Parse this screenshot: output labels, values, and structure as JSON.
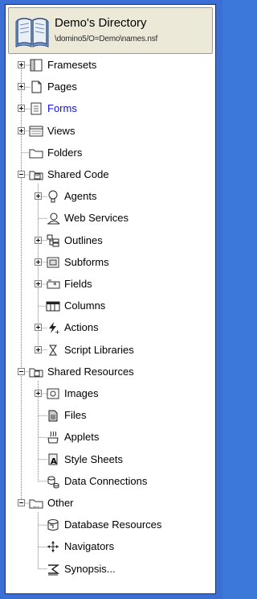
{
  "header": {
    "title": "Demo's Directory",
    "path": "\\domino5/O=Demo\\names.nsf"
  },
  "tree": [
    {
      "label": "Framesets",
      "icon": "frameset-icon",
      "expander": "plus"
    },
    {
      "label": "Pages",
      "icon": "page-icon",
      "expander": "plus"
    },
    {
      "label": "Forms",
      "icon": "form-icon",
      "expander": "plus",
      "active": true
    },
    {
      "label": "Views",
      "icon": "view-icon",
      "expander": "plus"
    },
    {
      "label": "Folders",
      "icon": "folder-icon",
      "expander": "none"
    },
    {
      "label": "Shared Code",
      "icon": "shared-code-icon",
      "expander": "minus"
    },
    {
      "label": "Agents",
      "icon": "agent-icon",
      "expander": "plus"
    },
    {
      "label": "Web Services",
      "icon": "web-services-icon",
      "expander": "none"
    },
    {
      "label": "Outlines",
      "icon": "outline-icon",
      "expander": "plus"
    },
    {
      "label": "Subforms",
      "icon": "subform-icon",
      "expander": "plus"
    },
    {
      "label": "Fields",
      "icon": "field-icon",
      "expander": "plus"
    },
    {
      "label": "Columns",
      "icon": "column-icon",
      "expander": "none"
    },
    {
      "label": "Actions",
      "icon": "action-icon",
      "expander": "plus"
    },
    {
      "label": "Script Libraries",
      "icon": "script-library-icon",
      "expander": "plus"
    },
    {
      "label": "Shared Resources",
      "icon": "shared-resources-icon",
      "expander": "minus"
    },
    {
      "label": "Images",
      "icon": "image-icon",
      "expander": "plus"
    },
    {
      "label": "Files",
      "icon": "file-icon",
      "expander": "none"
    },
    {
      "label": "Applets",
      "icon": "applet-icon",
      "expander": "none"
    },
    {
      "label": "Style Sheets",
      "icon": "style-sheet-icon",
      "expander": "none"
    },
    {
      "label": "Data Connections",
      "icon": "data-connection-icon",
      "expander": "none"
    },
    {
      "label": "Other",
      "icon": "other-icon",
      "expander": "minus"
    },
    {
      "label": "Database Resources",
      "icon": "database-resource-icon",
      "expander": "none"
    },
    {
      "label": "Navigators",
      "icon": "navigator-icon",
      "expander": "none"
    },
    {
      "label": "Synopsis...",
      "icon": "synopsis-icon",
      "expander": "none"
    }
  ],
  "colors": {
    "active": "#1010e0",
    "frame": "#3b6fd6",
    "header_bg": "#ece9d8"
  }
}
